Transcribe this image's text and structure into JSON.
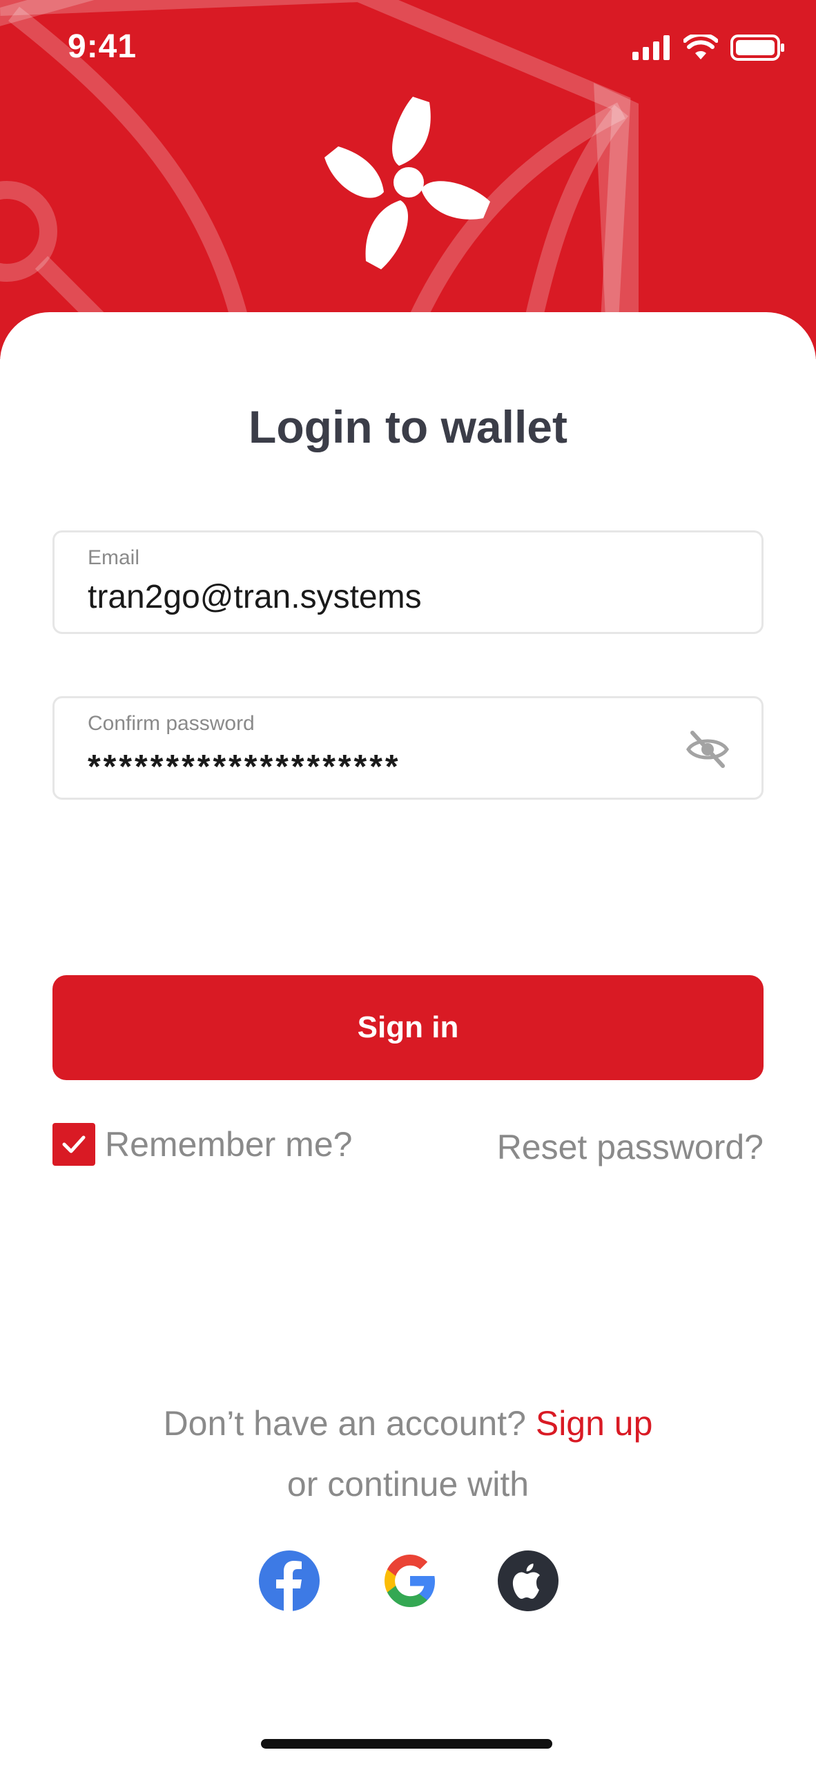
{
  "status_bar": {
    "time": "9:41",
    "icons": [
      "signal-icon",
      "wifi-icon",
      "battery-icon"
    ]
  },
  "header": {
    "logo": "brand-logo"
  },
  "title": "Login to wallet",
  "form": {
    "email": {
      "label": "Email",
      "value": "tran2go@tran.systems"
    },
    "password": {
      "label": "Confirm password",
      "value": "********************",
      "toggle_icon": "eye-off-icon"
    },
    "sign_in_label": "Sign in",
    "remember_label": "Remember me?",
    "remember_checked": true,
    "reset_label": "Reset password?"
  },
  "footer": {
    "no_account_text": "Don’t have an account?",
    "sign_up_label": "Sign up",
    "continue_text": "or continue with",
    "social": [
      "facebook-icon",
      "google-icon",
      "apple-icon"
    ]
  },
  "colors": {
    "brand_red": "#d91a24",
    "title_text": "#3b3d48",
    "muted_text": "#8a8a8a",
    "facebook_blue": "#3d7ae5",
    "apple_dark": "#2b2f38"
  }
}
